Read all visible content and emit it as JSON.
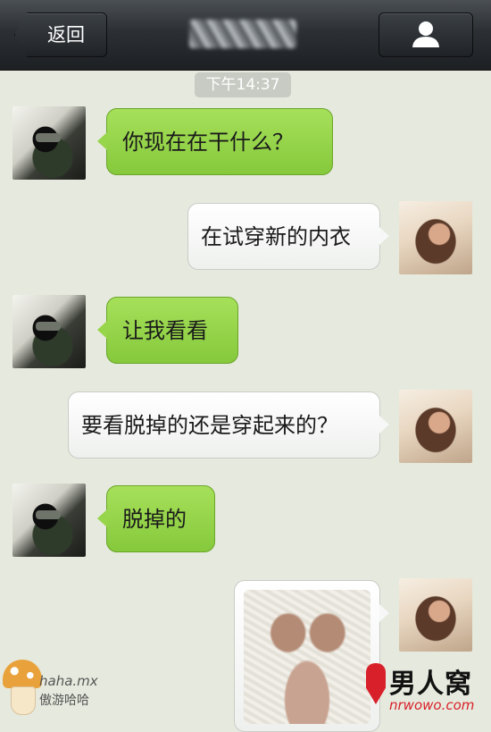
{
  "header": {
    "back_label": "返回",
    "contact_name": "",
    "profile_icon": "person-icon"
  },
  "timestamp": "下午14:37",
  "messages": [
    {
      "side": "in",
      "text": "你现在在干什么？"
    },
    {
      "side": "out",
      "text": "在试穿新的内衣"
    },
    {
      "side": "in",
      "text": "让我看看"
    },
    {
      "side": "out",
      "text": "要看脱掉的还是穿起来的？"
    },
    {
      "side": "in",
      "text": "脱掉的"
    },
    {
      "side": "out",
      "type": "image",
      "image": "photo-of-lingerie"
    }
  ],
  "watermarks": {
    "left_site": "haha.mx",
    "left_sub": "傲游哈哈",
    "right_brand": "男人窝",
    "right_domain": "nrwowo.com"
  },
  "colors": {
    "header_bg": "#2c3034",
    "chat_bg": "#e6e9dd",
    "incoming_bubble": "#97d54b",
    "outgoing_bubble": "#ffffff"
  }
}
